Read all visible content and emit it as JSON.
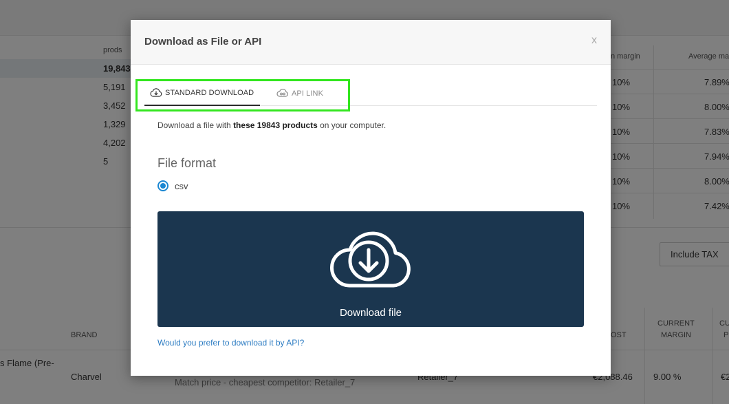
{
  "background": {
    "prods_header": "prods",
    "prods_values": [
      "19,843",
      "5,191",
      "3,452",
      "1,329",
      "4,202",
      "5"
    ],
    "margin_header_partial": "n margin",
    "margin_values": [
      "10%",
      "10%",
      "10%",
      "10%",
      "10%",
      "10%"
    ],
    "avg_margin_header": "Average ma",
    "avg_margin_values": [
      "7.89%",
      "8.00%",
      "7.83%",
      "7.94%",
      "8.00%",
      "7.42%"
    ],
    "include_tax_label": "Include TAX",
    "table2": {
      "brand_header": "BRAND",
      "cost_header": "OST",
      "current_margin_line1": "CURRENT",
      "current_margin_line2": "MARGIN",
      "cut_header_line1": "CU",
      "cut_header_line2": "P",
      "row_name": "s Flame (Pre-",
      "row_brand": "Charvel",
      "row_match": "Match price - cheapest competitor: Retailer_7",
      "row_retailer": "Retailer_7",
      "row_cost": "€2,088.46",
      "row_margin": "9.00 %",
      "row_cut": "€2"
    }
  },
  "modal": {
    "title": "Download as File or API",
    "close_label": "x",
    "tabs": {
      "standard": "STANDARD DOWNLOAD",
      "api": "API LINK"
    },
    "desc_prefix": "Download a file with ",
    "desc_bold": "these 19843 products",
    "desc_suffix": " on your computer.",
    "file_format_label": "File format",
    "format_option": "csv",
    "download_label": "Download file",
    "api_link": "Would you prefer to download it by API?"
  },
  "colors": {
    "download_bg": "#1b364f",
    "link": "#2b7bc2",
    "radio": "#1b87d2",
    "highlight": "#33e61f"
  },
  "icons": {
    "standard_tab": "cloud-download-icon",
    "api_tab": "cloud-link-icon",
    "download_button": "cloud-download-icon"
  }
}
